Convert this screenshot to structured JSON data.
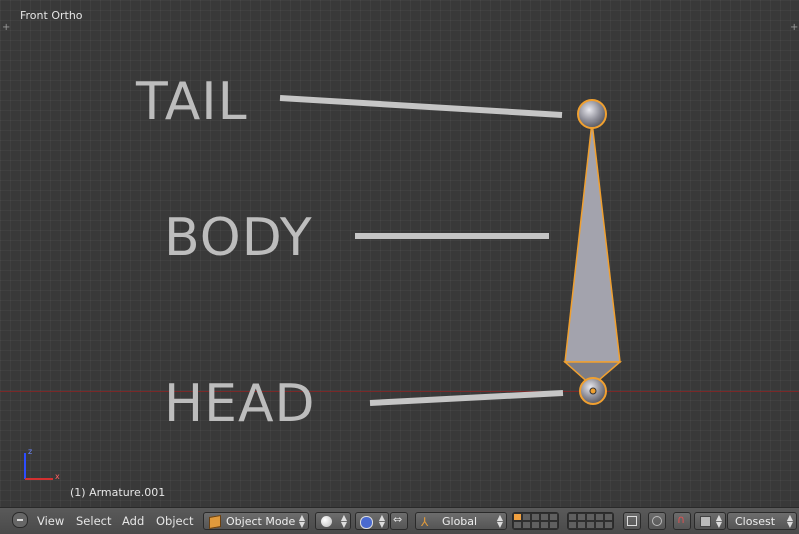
{
  "viewport": {
    "title": "Front Ortho",
    "object_info": "(1) Armature.001",
    "labels": {
      "tail": "TAIL",
      "body": "BODY",
      "head": "HEAD"
    },
    "gizmo": {
      "x_label": "x",
      "z_label": "z"
    }
  },
  "header": {
    "menu_icon": "dash-icon",
    "menu": [
      "View",
      "Select",
      "Add",
      "Object"
    ],
    "mode": "Object Mode",
    "orientation": "Global",
    "snap_target": "Closest"
  },
  "colors": {
    "background": "#393939",
    "bone_fill": "#9e9ea8",
    "bone_outline": "#f0a030",
    "label": "#bdbdbd",
    "x_axis": "#7a2828"
  }
}
